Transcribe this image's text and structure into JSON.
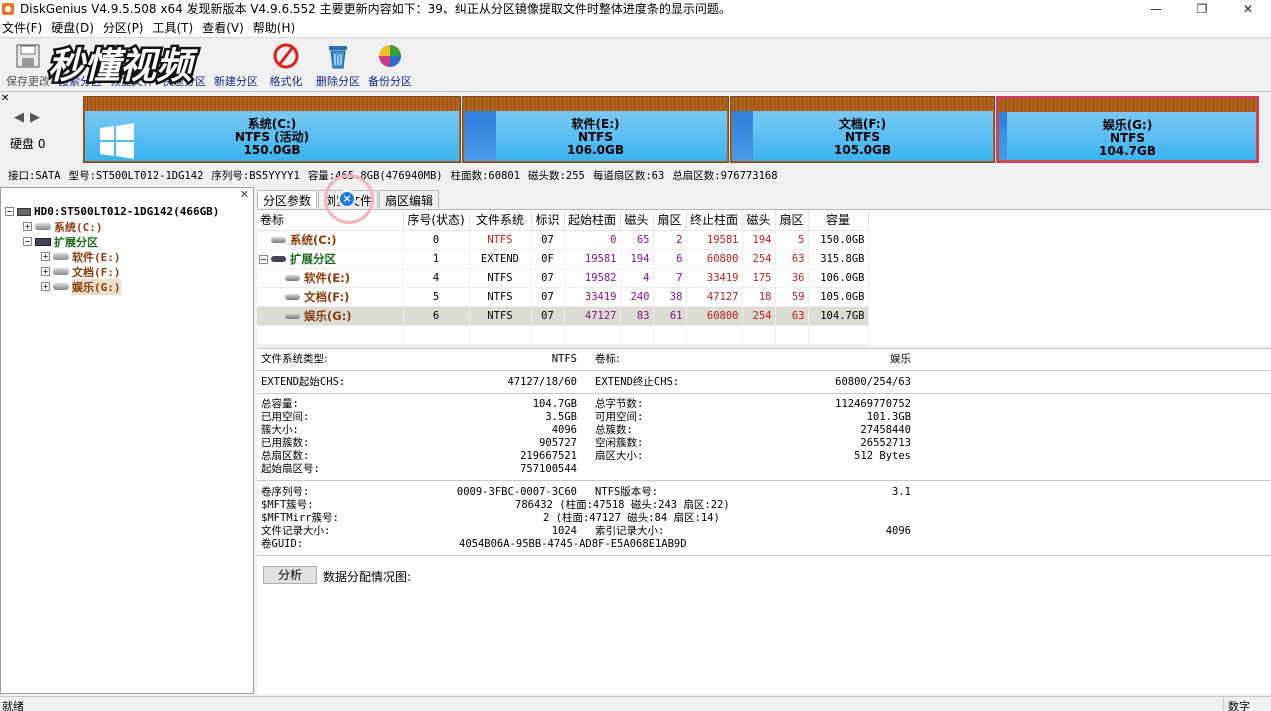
{
  "window": {
    "title": "DiskGenius V4.9.5.508 x64    发现新版本 V4.9.6.552 主要更新内容如下：39、纠正从分区镜像提取文件时整体进度条的显示问题。",
    "controls": [
      "—",
      "❐",
      "✕"
    ]
  },
  "menu": [
    "文件(F)",
    "硬盘(D)",
    "分区(P)",
    "工具(T)",
    "查看(V)",
    "帮助(H)"
  ],
  "toolbar": {
    "save": "保存更改",
    "search": "搜索分区",
    "recover": "恢复文件",
    "quick": "快速分区",
    "new": "新建分区",
    "format": "格式化",
    "delete": "删除分区",
    "backup": "备份分区"
  },
  "watermark": "秒懂视频",
  "disk": {
    "label": "硬盘 0",
    "partitions": [
      {
        "name": "系统(C:)",
        "fs": "NTFS (活动)",
        "size": "150.0GB",
        "used_fraction": 0.0
      },
      {
        "name": "软件(E:)",
        "fs": "NTFS",
        "size": "106.0GB",
        "used_fraction": 0.12
      },
      {
        "name": "文档(F:)",
        "fs": "NTFS",
        "size": "105.0GB",
        "used_fraction": 0.08
      },
      {
        "name": "娱乐(G:)",
        "fs": "NTFS",
        "size": "104.7GB",
        "used_fraction": 0.03
      }
    ]
  },
  "infoline": {
    "iface": "接口:SATA",
    "model": "型号:ST500LT012-1DG142",
    "serial": "序列号:BS5YYYY1",
    "capacity": "容量:465.8GB(476940MB)",
    "cylinders": "柱面数:60801",
    "heads": "磁头数:255",
    "sectors": "每道扇区数:63",
    "total": "总扇区数:976773168"
  },
  "tree": {
    "disk": "HD0:ST500LT012-1DG142(466GB)",
    "c": "系统(C:)",
    "ext": "扩展分区",
    "e": "软件(E:)",
    "f": "文档(F:)",
    "g": "娱乐(G:)"
  },
  "tabs": [
    "分区参数",
    "浏览文件",
    "扇区编辑"
  ],
  "table": {
    "headers": [
      "卷标",
      "序号(状态)",
      "文件系统",
      "标识",
      "起始柱面",
      "磁头",
      "扇区",
      "终止柱面",
      "磁头",
      "扇区",
      "容量"
    ],
    "rows": [
      [
        "系统(C:)",
        "0",
        "NTFS",
        "07",
        "0",
        "65",
        "2",
        "19581",
        "194",
        "5",
        "150.0GB"
      ],
      [
        "扩展分区",
        "1",
        "EXTEND",
        "0F",
        "19581",
        "194",
        "6",
        "60800",
        "254",
        "63",
        "315.8GB"
      ],
      [
        "软件(E:)",
        "4",
        "NTFS",
        "07",
        "19582",
        "4",
        "7",
        "33419",
        "175",
        "36",
        "106.0GB"
      ],
      [
        "文档(F:)",
        "5",
        "NTFS",
        "07",
        "33419",
        "240",
        "38",
        "47127",
        "18",
        "59",
        "105.0GB"
      ],
      [
        "娱乐(G:)",
        "6",
        "NTFS",
        "07",
        "47127",
        "83",
        "61",
        "60800",
        "254",
        "63",
        "104.7GB"
      ]
    ]
  },
  "details": {
    "fs_type_label": "文件系统类型:",
    "fs_type": "NTFS",
    "vol_label_label": "卷标:",
    "vol_label": "娱乐",
    "ext_start_label": "EXTEND起始CHS:",
    "ext_start": "47127/18/60",
    "ext_end_label": "EXTEND终止CHS:",
    "ext_end": "60800/254/63",
    "total_cap_label": "总容量:",
    "total_cap": "104.7GB",
    "total_bytes_label": "总字节数:",
    "total_bytes": "112469770752",
    "used_label": "已用空间:",
    "used": "3.5GB",
    "free_label": "可用空间:",
    "free": "101.3GB",
    "cluster_label": "簇大小:",
    "cluster": "4096",
    "total_clusters_label": "总簇数:",
    "total_clusters": "27458440",
    "used_clusters_label": "已用簇数:",
    "used_clusters": "905727",
    "free_clusters_label": "空闲簇数:",
    "free_clusters": "26552713",
    "total_sectors_label": "总扇区数:",
    "total_sectors": "219667521",
    "sector_size_label": "扇区大小:",
    "sector_size": "512 Bytes",
    "start_sector_label": "起始扇区号:",
    "start_sector": "757100544",
    "serial_label": "卷序列号:",
    "serial": "0009-3FBC-0007-3C60",
    "ntfs_ver_label": "NTFS版本号:",
    "ntfs_ver": "3.1",
    "mft_label": "$MFT簇号:",
    "mft": "786432 (柱面:47518 磁头:243 扇区:22)",
    "mftmirr_label": "$MFTMirr簇号:",
    "mftmirr": "2 (柱面:47127 磁头:84 扇区:14)",
    "rec_size_label": "文件记录大小:",
    "rec_size": "1024",
    "idx_size_label": "索引记录大小:",
    "idx_size": "4096",
    "guid_label": "卷GUID:",
    "guid": "4054B06A-95BB-4745-AD8F-E5A068E1AB9D",
    "analyze": "分析",
    "dist": "数据分配情况图:"
  },
  "status": {
    "left": "就绪",
    "right": "数字"
  }
}
